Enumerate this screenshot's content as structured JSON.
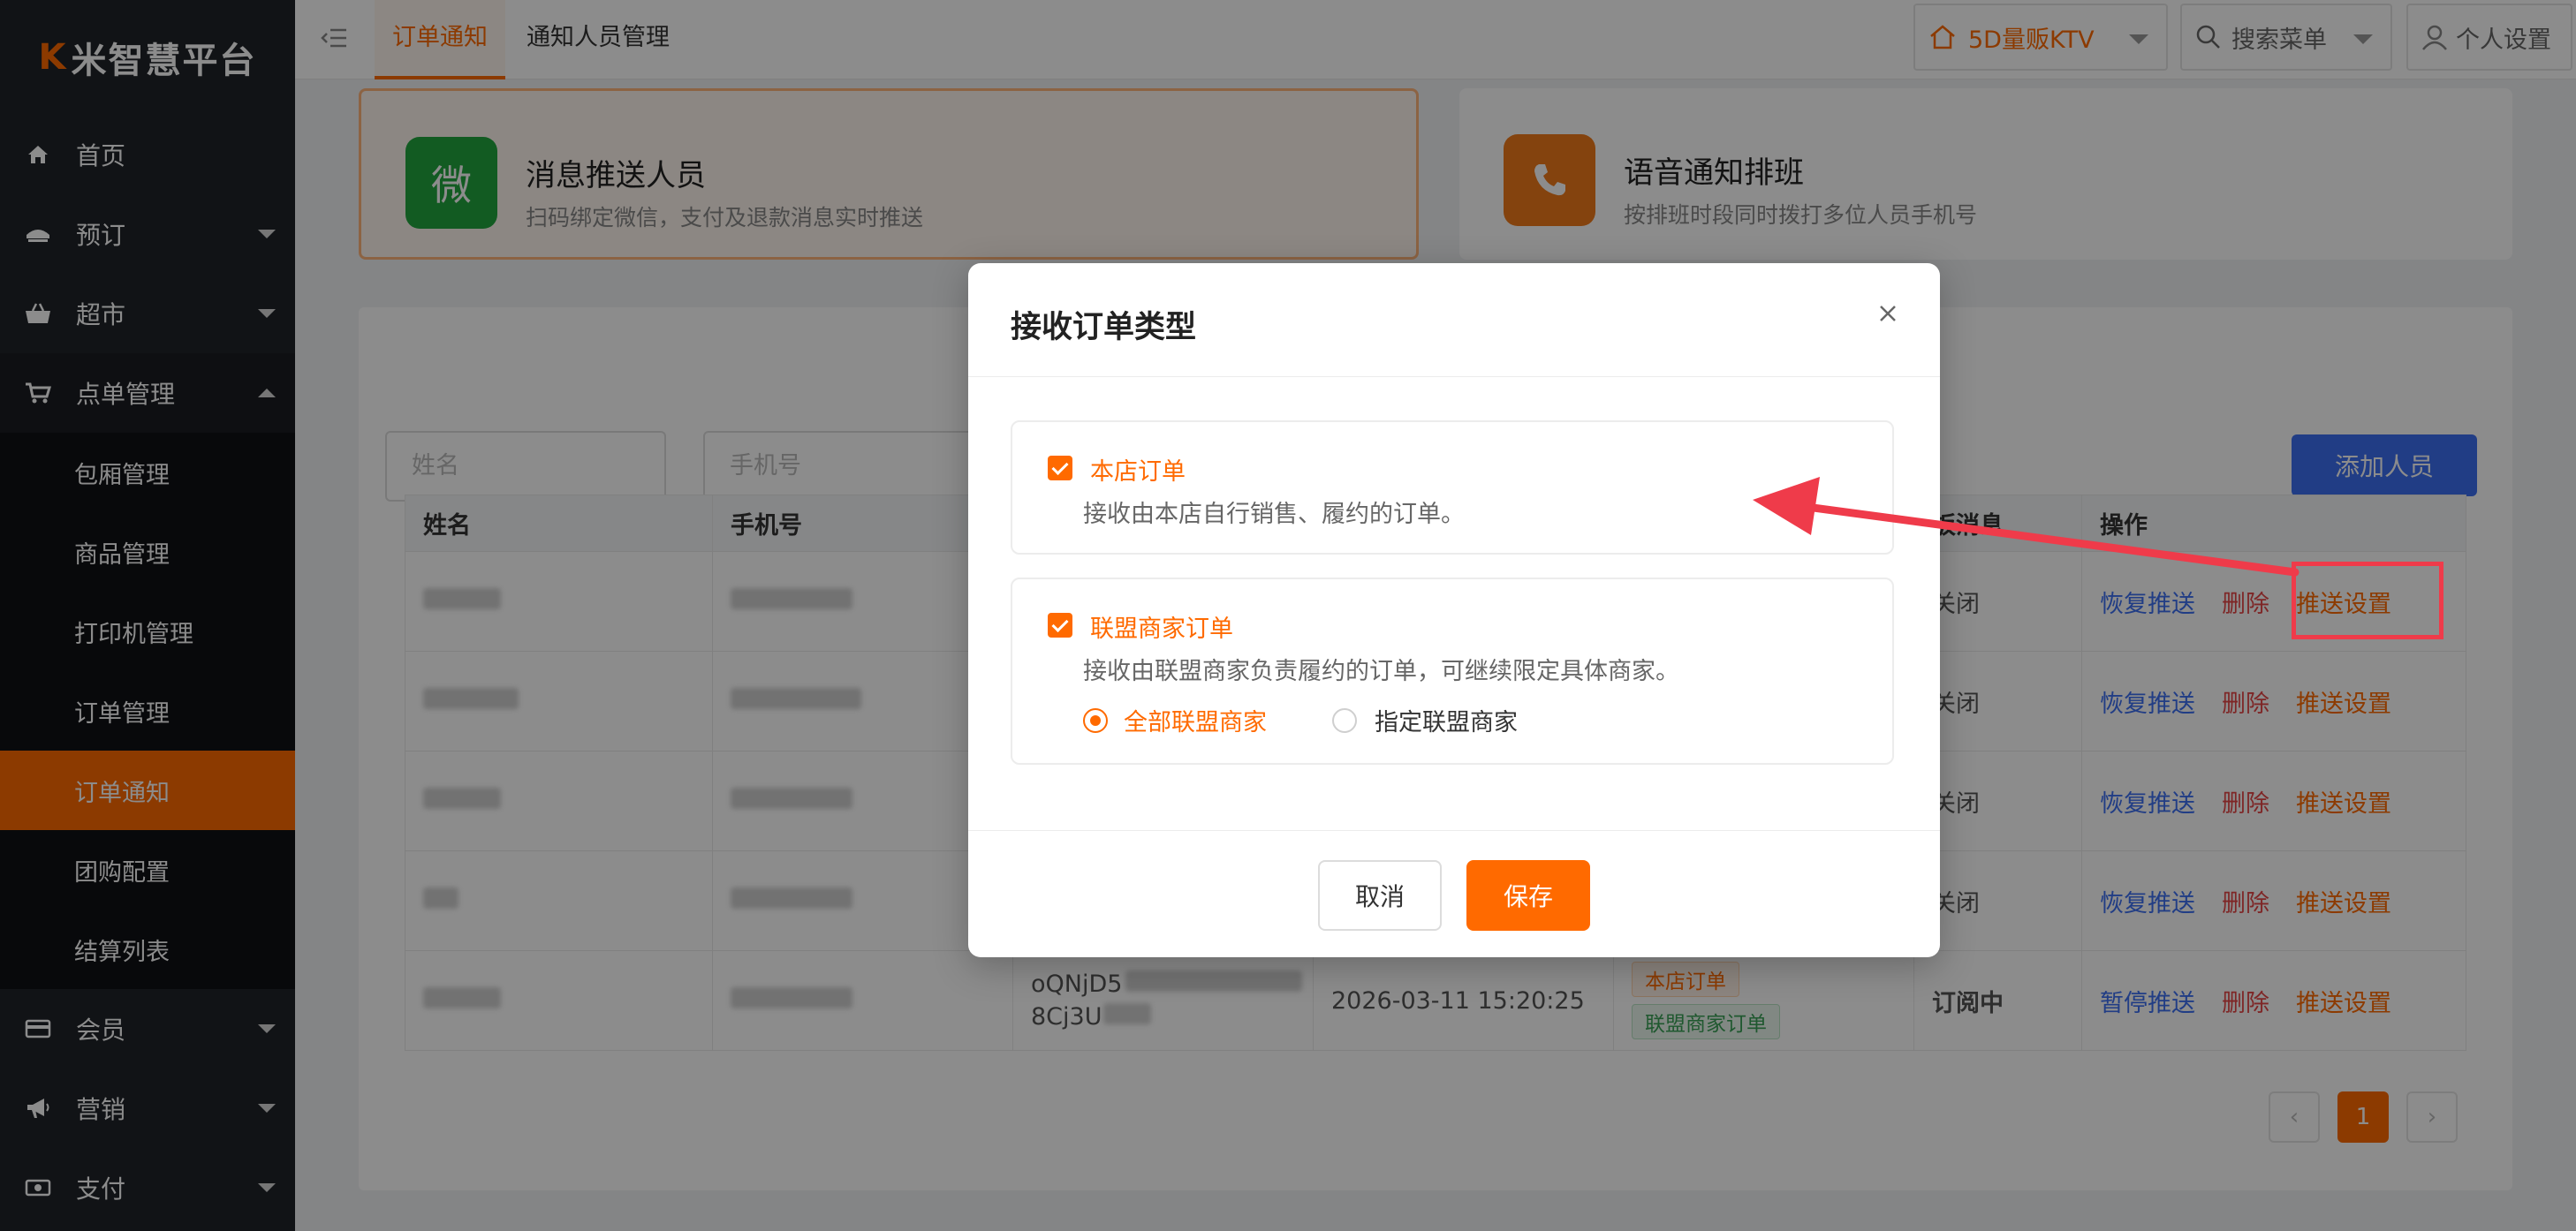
{
  "app": {
    "logo": "K米智慧平台",
    "logo_mark": "K",
    "logo_text": "米智慧平台"
  },
  "sidebar": {
    "items": [
      {
        "label": "首页",
        "icon": "home-icon"
      },
      {
        "label": "预订",
        "icon": "booking-icon",
        "caret": true
      },
      {
        "label": "超市",
        "icon": "basket-icon",
        "caret": true
      },
      {
        "label": "点单管理",
        "icon": "cart-icon",
        "caret": true,
        "open": true
      },
      {
        "label": "会员",
        "icon": "card-icon",
        "caret": true
      },
      {
        "label": "营销",
        "icon": "megaphone-icon",
        "caret": true
      },
      {
        "label": "支付",
        "icon": "money-icon",
        "caret": true
      }
    ],
    "sub_items": [
      "包厢管理",
      "商品管理",
      "打印机管理",
      "订单管理",
      "订单通知",
      "团购配置",
      "结算列表"
    ],
    "active_sub": "订单通知"
  },
  "topbar": {
    "tabs": [
      "订单通知",
      "通知人员管理"
    ],
    "store": "5D量贩KTV",
    "search_menu": "搜索菜单",
    "personal": "个人设置"
  },
  "features": [
    {
      "title": "消息推送人员",
      "desc": "扫码绑定微信，支付及退款消息实时推送",
      "icon_char": "微"
    },
    {
      "title": "语音通知排班",
      "desc": "按排班时段同时拨打多位人员手机号"
    }
  ],
  "filters": {
    "name_placeholder": "姓名",
    "phone_placeholder": "手机号",
    "add_button": "添加人员"
  },
  "table": {
    "headers": [
      "姓名",
      "手机号",
      "",
      "",
      "",
      "板消息",
      "操作"
    ],
    "rows": [
      {
        "status": "关闭",
        "actions": [
          "恢复推送",
          "删除",
          "推送设置"
        ]
      },
      {
        "status": "关闭",
        "actions": [
          "恢复推送",
          "删除",
          "推送设置"
        ]
      },
      {
        "status": "关闭",
        "actions": [
          "恢复推送",
          "删除",
          "推送设置"
        ]
      },
      {
        "status": "关闭",
        "actions": [
          "恢复推送",
          "删除",
          "推送设置"
        ]
      },
      {
        "openid_line1": "oQNjD5",
        "openid_line2": "8Cj3U",
        "time": "2026-03-11 15:20:25",
        "tags": [
          "本店订单",
          "联盟商家订单"
        ],
        "status": "订阅中",
        "actions": [
          "暂停推送",
          "删除",
          "推送设置"
        ]
      }
    ]
  },
  "pagination": {
    "current": "1",
    "prev": "‹",
    "next": "›"
  },
  "modal": {
    "title": "接收订单类型",
    "option1": {
      "title": "本店订单",
      "desc": "接收由本店自行销售、履约的订单。",
      "checked": true
    },
    "option2": {
      "title": "联盟商家订单",
      "desc": "接收由联盟商家负责履约的订单，可继续限定具体商家。",
      "checked": true
    },
    "radio_all": "全部联盟商家",
    "radio_specific": "指定联盟商家",
    "cancel": "取消",
    "save": "保存"
  },
  "colors": {
    "brand": "#ff6a00",
    "primary_blue": "#3d6ff2",
    "danger": "#e64545",
    "annotation_red": "#ef3b4a"
  }
}
